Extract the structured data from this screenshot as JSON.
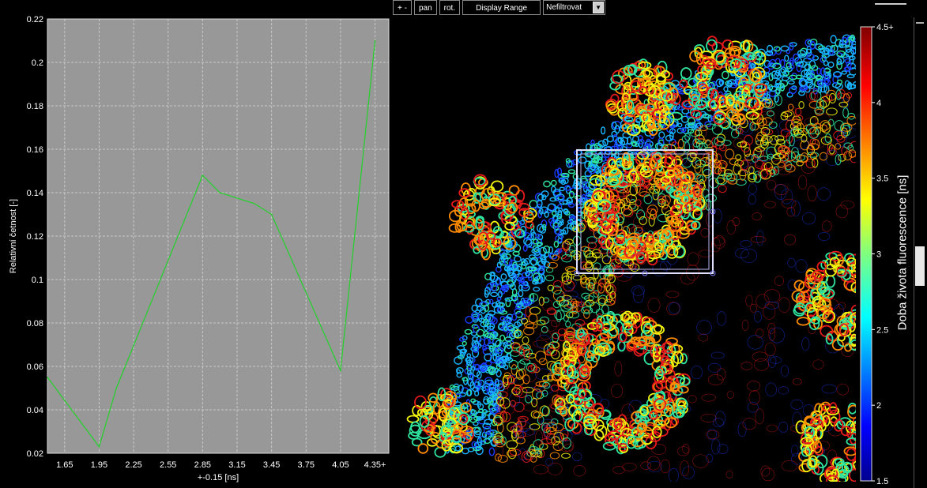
{
  "toolbar": {
    "zoom_label": "+ -",
    "pan_label": "pan",
    "rot_label": "rot.",
    "display_range_label": "Display Range",
    "filter_select": {
      "selected": "Nefiltrovat"
    }
  },
  "chart_data": {
    "type": "line",
    "xlabel": "+-0.15 [ns]",
    "ylabel": "Relativní četnost [-]",
    "categories": [
      "1.65",
      "1.95",
      "2.25",
      "2.55",
      "2.85",
      "3.15",
      "3.45",
      "3.75",
      "4.05",
      "4.35+"
    ],
    "x_centers": [
      1.65,
      1.95,
      2.25,
      2.55,
      2.85,
      3.15,
      3.45,
      3.75,
      4.05,
      4.35
    ],
    "y_ticks": [
      0.02,
      0.04,
      0.06,
      0.08,
      0.1,
      0.12,
      0.14,
      0.16,
      0.18,
      0.2,
      0.22
    ],
    "ylim": [
      0.02,
      0.22
    ],
    "grid": true,
    "series": [
      {
        "color": "#22d12a",
        "x": [
          1.5,
          1.95,
          2.1,
          2.85,
          3.0,
          3.3,
          3.45,
          4.05,
          4.35
        ],
        "y": [
          0.055,
          0.023,
          0.05,
          0.148,
          0.14,
          0.135,
          0.13,
          0.058,
          0.21
        ]
      }
    ]
  },
  "colorbar": {
    "label": "Doba života fluorescence [ns]",
    "ticks": [
      "4.5+",
      "4",
      "3.5",
      "3",
      "2.5",
      "2",
      "1.5"
    ],
    "range": [
      1.5,
      4.5
    ]
  },
  "image": {
    "description_colors": [
      "#1a3cff",
      "#19b3ff",
      "#2ee6a0",
      "#f2f20f",
      "#ff8c00",
      "#e61a1a"
    ]
  }
}
